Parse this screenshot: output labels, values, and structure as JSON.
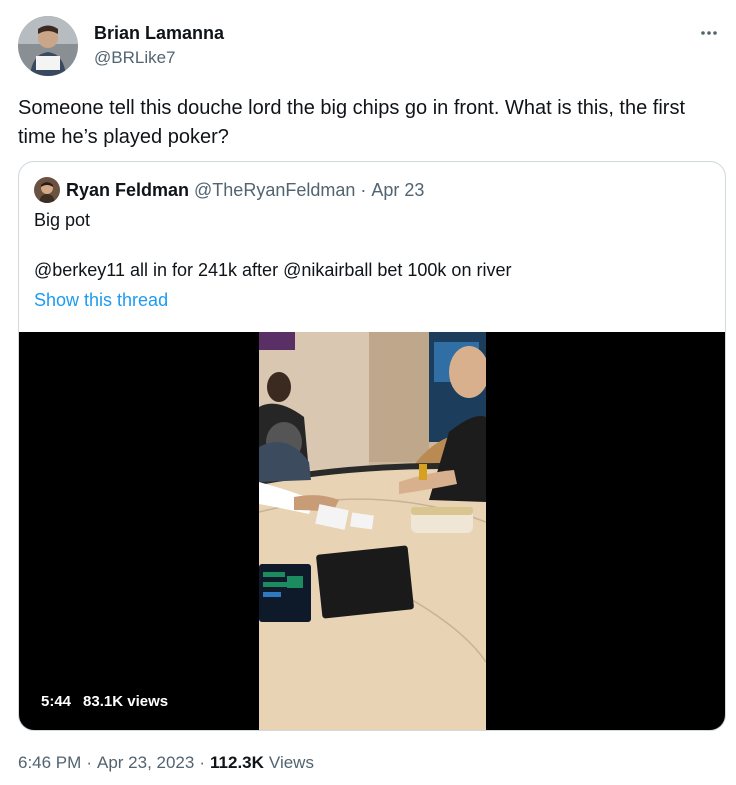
{
  "tweet": {
    "author": {
      "name": "Brian Lamanna",
      "handle": "@BRLike7"
    },
    "more_icon": "ellipsis-icon",
    "text": "Someone tell this douche lord the big chips go in front. What is this, the first time he’s played poker?",
    "quoted": {
      "author": {
        "name": "Ryan Feldman",
        "handle": "@TheRyanFeldman"
      },
      "separator": "·",
      "date": "Apr 23",
      "text_line1": "Big pot",
      "text_line2": "@berkey11 all in for 241k after @nikairball bet 100k on river",
      "show_thread": "Show this thread",
      "video": {
        "duration": "5:44",
        "views": "83.1K views"
      }
    },
    "meta": {
      "time": "6:46 PM",
      "sep1": "·",
      "date": "Apr 23, 2023",
      "sep2": "·",
      "views_count": "112.3K",
      "views_label": "Views"
    }
  },
  "colors": {
    "text": "#0f1419",
    "secondary": "#536471",
    "link": "#1d9bf0",
    "border": "#cfd9de"
  }
}
